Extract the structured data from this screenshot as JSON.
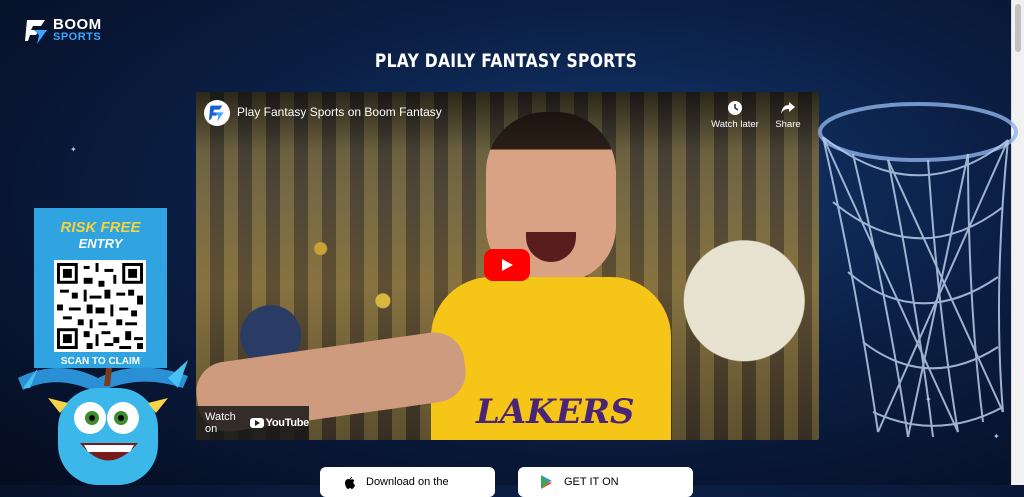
{
  "brand": {
    "line1": "Boom",
    "line2": "SPORTS"
  },
  "headline": "PLAY DAILY FANTASY SPORTS",
  "video": {
    "title": "Play Fantasy Sports on Boom Fantasy",
    "watch_later": "Watch later",
    "share": "Share",
    "watch_on": "Watch on",
    "youtube": "YouTube",
    "jersey_text": "LAKERS"
  },
  "promo": {
    "line1": "RISK FREE",
    "line2": "ENTRY",
    "scan": "SCAN TO CLAIM"
  },
  "stores": {
    "apple": "Download on the",
    "google": "GET IT ON"
  },
  "colors": {
    "accent_blue": "#2fa4e0",
    "promo_yellow": "#f7d23c",
    "play_red": "#ff0000"
  }
}
